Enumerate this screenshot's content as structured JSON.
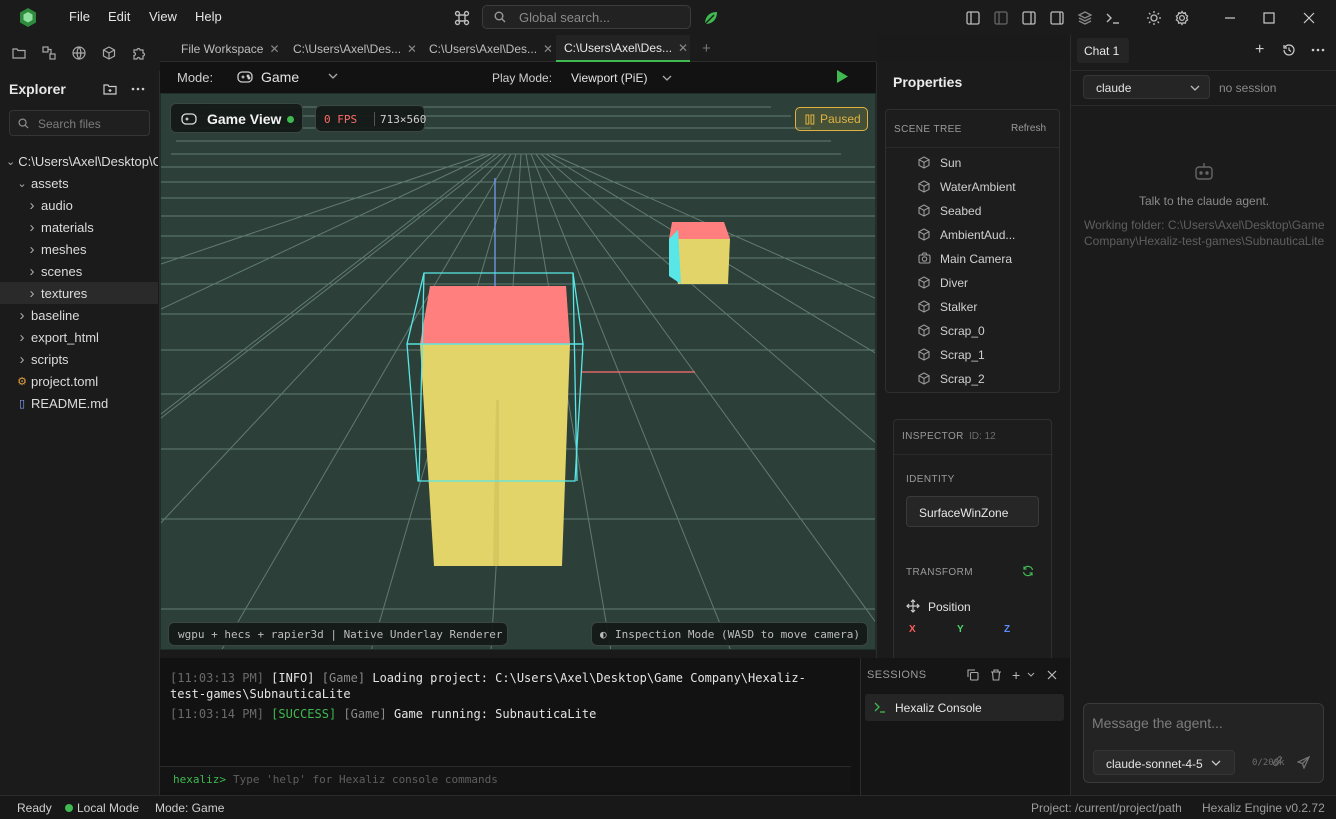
{
  "menu": {
    "file": "File",
    "edit": "Edit",
    "view": "View",
    "help": "Help"
  },
  "search": {
    "placeholder": "Global search..."
  },
  "explorer": {
    "title": "Explorer",
    "search_placeholder": "Search files",
    "root": "C:\\Users\\Axel\\Desktop\\Game Company\\Hexaliz-test-games\\SubnauticaLite",
    "items": [
      {
        "label": "assets",
        "type": "folder",
        "open": true,
        "depth": 1
      },
      {
        "label": "audio",
        "type": "folder",
        "open": false,
        "depth": 2
      },
      {
        "label": "materials",
        "type": "folder",
        "open": false,
        "depth": 2
      },
      {
        "label": "meshes",
        "type": "folder",
        "open": false,
        "depth": 2
      },
      {
        "label": "scenes",
        "type": "folder",
        "open": false,
        "depth": 2
      },
      {
        "label": "textures",
        "type": "folder",
        "open": false,
        "depth": 2,
        "selected": true
      },
      {
        "label": "baseline",
        "type": "folder",
        "open": false,
        "depth": 1
      },
      {
        "label": "export_html",
        "type": "folder",
        "open": false,
        "depth": 1
      },
      {
        "label": "scripts",
        "type": "folder",
        "open": false,
        "depth": 1
      },
      {
        "label": "project.toml",
        "type": "file",
        "depth": 1
      },
      {
        "label": "README.md",
        "type": "file",
        "depth": 1
      }
    ]
  },
  "tabs": [
    {
      "label": "File Workspace",
      "active": false
    },
    {
      "label": "C:\\Users\\Axel\\Des...",
      "active": false
    },
    {
      "label": "C:\\Users\\Axel\\Des...",
      "active": false
    },
    {
      "label": "C:\\Users\\Axel\\Des...",
      "active": true
    }
  ],
  "modebar": {
    "mode_label": "Mode:",
    "mode_value": "Game",
    "play_mode_label": "Play Mode:",
    "play_mode_value": "Viewport (PiE)"
  },
  "viewport": {
    "title": "Game View",
    "fps": "0 FPS",
    "resolution": "713×560",
    "status": "Paused",
    "renderer": "wgpu + hecs + rapier3d | Native Underlay Renderer",
    "inspection": "Inspection Mode (WASD to move camera)"
  },
  "properties": {
    "title": "Properties",
    "scene_tree_label": "SCENE TREE",
    "refresh": "Refresh",
    "scene_items": [
      {
        "label": "Sun",
        "icon": "cube"
      },
      {
        "label": "WaterAmbient",
        "icon": "cube"
      },
      {
        "label": "Seabed",
        "icon": "cube"
      },
      {
        "label": "AmbientAud...",
        "icon": "cube"
      },
      {
        "label": "Main Camera",
        "icon": "camera"
      },
      {
        "label": "Diver",
        "icon": "cube"
      },
      {
        "label": "Stalker",
        "icon": "cube"
      },
      {
        "label": "Scrap_0",
        "icon": "cube"
      },
      {
        "label": "Scrap_1",
        "icon": "cube"
      },
      {
        "label": "Scrap_2",
        "icon": "cube"
      }
    ],
    "inspector_label": "INSPECTOR",
    "inspector_id": "ID: 12",
    "identity_label": "IDENTITY",
    "identity_value": "SurfaceWinZone",
    "transform_label": "TRANSFORM",
    "position_label": "Position",
    "x": "X",
    "y": "Y",
    "z": "Z"
  },
  "console": {
    "lines": [
      {
        "time": "[11:03:13 PM]",
        "level": "[INFO]",
        "source": "[Game]",
        "msg": "Loading project: C:\\Users\\Axel\\Desktop\\Game Company\\Hexaliz-test-games\\SubnauticaLite"
      },
      {
        "time": "[11:03:14 PM]",
        "level": "[SUCCESS]",
        "source": "[Game]",
        "msg": "Game running: SubnauticaLite"
      }
    ],
    "prompt": "hexaliz>",
    "placeholder": "Type 'help' for Hexaliz console commands"
  },
  "sessions": {
    "title": "SESSIONS",
    "items": [
      {
        "label": "Hexaliz Console"
      }
    ]
  },
  "chat": {
    "tab": "Chat 1",
    "agent": "claude",
    "session": "no session",
    "talk": "Talk to the claude agent.",
    "working_folder": "Working folder: C:\\Users\\Axel\\Desktop\\Game Company\\Hexaliz-test-games\\SubnauticaLite",
    "placeholder": "Message the agent...",
    "model": "claude-sonnet-4-5",
    "counter": "0/200k"
  },
  "status": {
    "ready": "Ready",
    "local": "Local Mode",
    "mode": "Mode: Game",
    "project": "Project: /current/project/path",
    "engine": "Hexaliz Engine v0.2.72"
  },
  "colors": {
    "accent": "#3fb950",
    "paused": "#e0b341",
    "cube_top": "#ff7f7f",
    "cube_side": "#e3d46a",
    "cube_cyan": "#58e6e6",
    "viewport_bg": "#2c4039"
  }
}
